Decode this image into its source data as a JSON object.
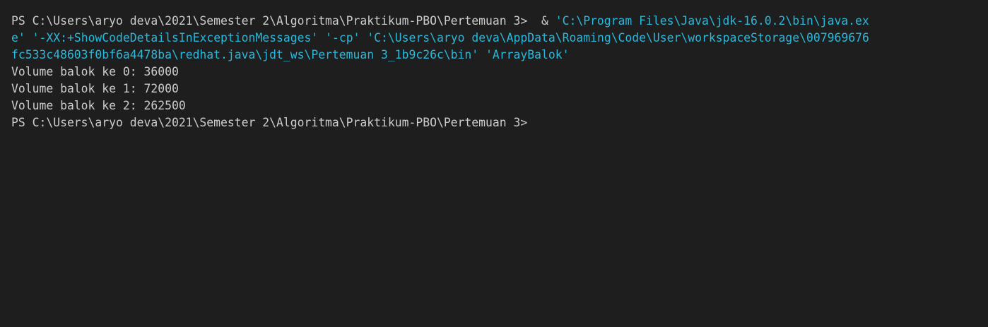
{
  "terminal": {
    "colors": {
      "background": "#1e1e1e",
      "text": "#cccccc",
      "string": "#29b8db"
    },
    "command": {
      "prompt": "PS C:\\Users\\aryo deva\\2021\\Semester 2\\Algoritma\\Praktikum-PBO\\Pertemuan 3>",
      "operator": "  & ",
      "line1_arg": "'C:\\Program Files\\Java\\jdk-16.0.2\\bin\\java.ex",
      "line2_arg_end": "e'",
      "line2_flag": "'-XX:+ShowCodeDetailsInExceptionMessages'",
      "line2_cp": "'-cp'",
      "line2_path_start": "'C:\\Users\\aryo deva\\AppData\\Roaming\\Code\\User\\workspaceStorage\\007969676",
      "line3_path_end": "fc533c48603f0bf6a4478ba\\redhat.java\\jdt_ws\\Pertemuan 3_1b9c26c\\bin'",
      "line3_class": "'ArrayBalok'"
    },
    "output": [
      "Volume balok ke 0: 36000",
      "Volume balok ke 1: 72000",
      "Volume balok ke 2: 262500"
    ],
    "final_prompt": "PS C:\\Users\\aryo deva\\2021\\Semester 2\\Algoritma\\Praktikum-PBO\\Pertemuan 3>"
  }
}
